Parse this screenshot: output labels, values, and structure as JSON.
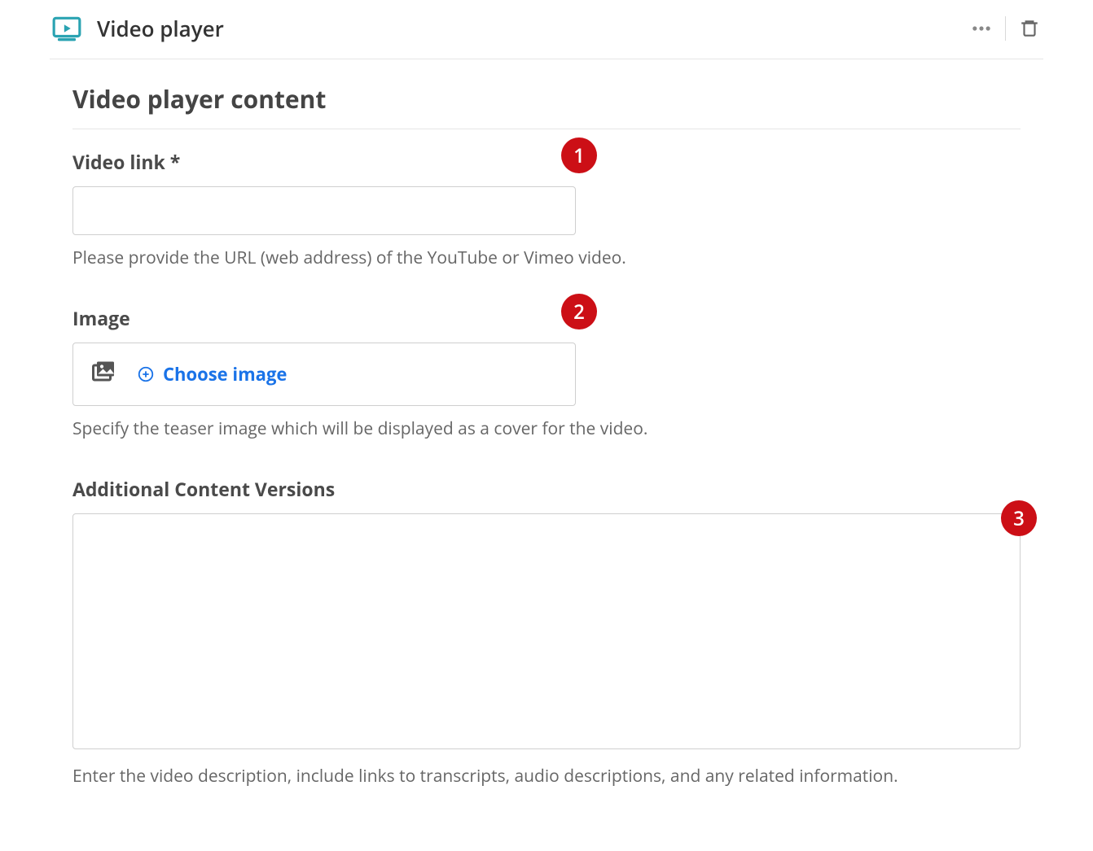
{
  "header": {
    "title": "Video player"
  },
  "section": {
    "title": "Video player content",
    "fields": {
      "video_link": {
        "label": "Video link *",
        "value": "",
        "help": "Please provide the URL (web address) of the YouTube or Vimeo video."
      },
      "image": {
        "label": "Image",
        "choose_label": "Choose image",
        "help": "Specify the teaser image which will be displayed as a cover for the video."
      },
      "additional": {
        "label": "Additional Content Versions",
        "value": "",
        "help": "Enter the video description, include links to transcripts, audio descriptions, and any related information."
      }
    }
  },
  "annotations": {
    "a1": "1",
    "a2": "2",
    "a3": "3"
  }
}
